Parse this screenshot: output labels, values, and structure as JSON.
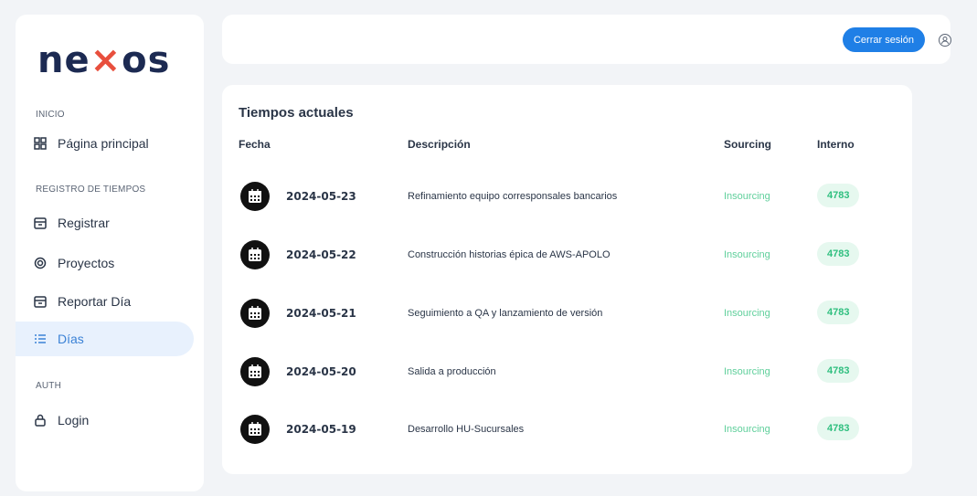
{
  "brand": {
    "logo_pre": "ne",
    "logo_x": "×",
    "logo_post": "os"
  },
  "sidebar": {
    "sections": [
      {
        "label": "INICIO"
      },
      {
        "label": "REGISTRO DE TIEMPOS"
      },
      {
        "label": "AUTH"
      }
    ],
    "items": [
      {
        "label": "Página principal",
        "icon": "dashboard-icon"
      },
      {
        "label": "Registrar",
        "icon": "calendar-icon"
      },
      {
        "label": "Proyectos",
        "icon": "settings-icon"
      },
      {
        "label": "Reportar Día",
        "icon": "calendar-icon"
      },
      {
        "label": "Días",
        "icon": "list-icon",
        "active": true
      },
      {
        "label": "Login",
        "icon": "lock-icon"
      }
    ]
  },
  "header": {
    "logout_label": "Cerrar sesión",
    "user_icon": "user-circle-icon"
  },
  "main": {
    "title": "Tiempos actuales",
    "columns": [
      "Fecha",
      "Descripción",
      "Sourcing",
      "Interno"
    ],
    "rows": [
      {
        "date": "2024-05-23",
        "description": "Refinamiento equipo corresponsales bancarios",
        "sourcing": "Insourcing",
        "interno": "4783"
      },
      {
        "date": "2024-05-22",
        "description": "Construcción historias épica de AWS-APOLO",
        "sourcing": "Insourcing",
        "interno": "4783"
      },
      {
        "date": "2024-05-21",
        "description": "Seguimiento a QA y lanzamiento de versión",
        "sourcing": "Insourcing",
        "interno": "4783"
      },
      {
        "date": "2024-05-20",
        "description": "Salida a producción",
        "sourcing": "Insourcing",
        "interno": "4783"
      },
      {
        "date": "2024-05-19",
        "description": "Desarrollo HU-Sucursales",
        "sourcing": "Insourcing",
        "interno": "4783"
      }
    ]
  },
  "colors": {
    "primary": "#1f7fe6",
    "active_bg": "#e8f1fd",
    "sourcing_green": "#5fcf9b",
    "badge_bg": "#e6f8ef",
    "brand_navy": "#1c2a52",
    "brand_red": "#e84f3d"
  }
}
